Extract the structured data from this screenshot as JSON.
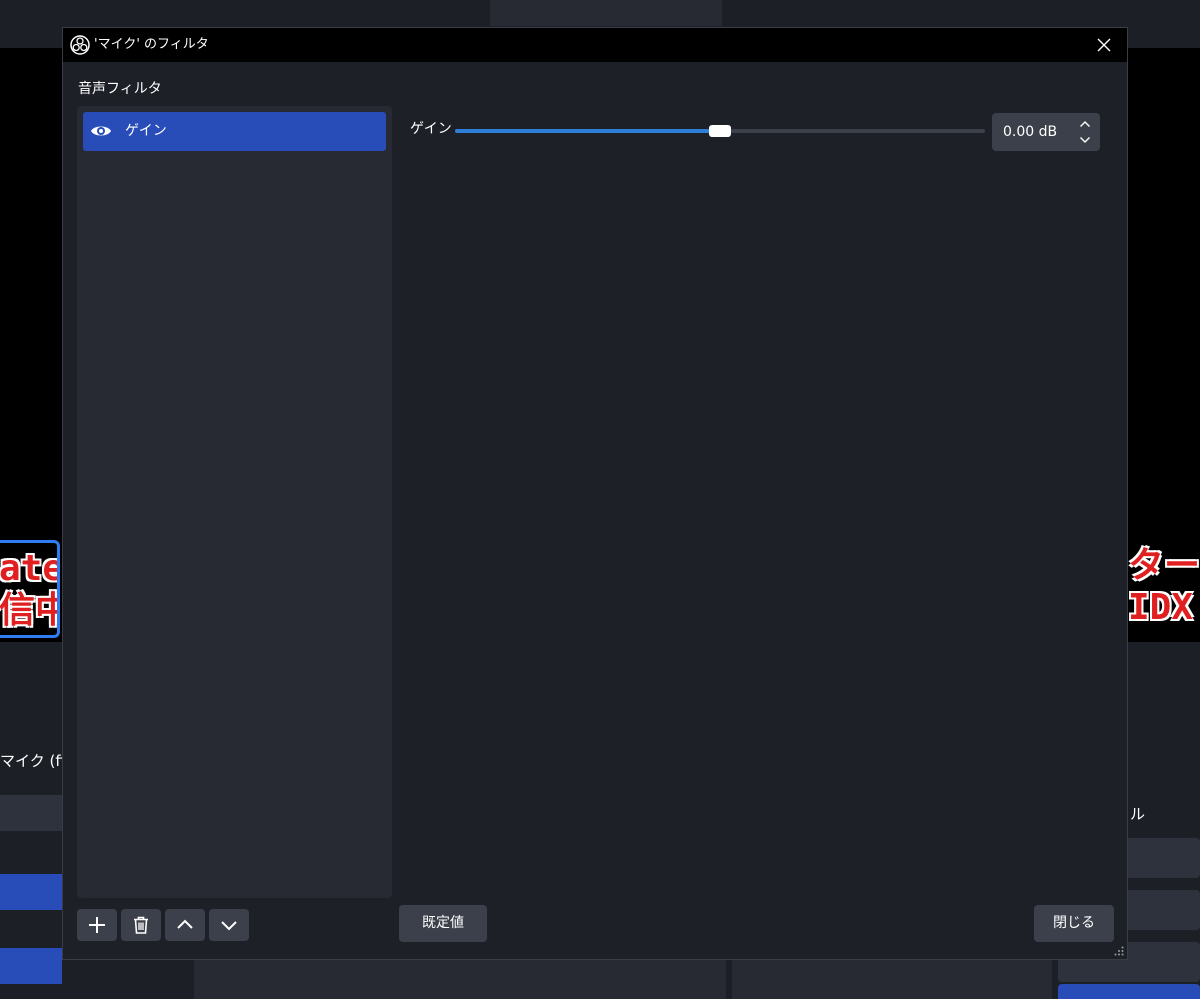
{
  "background": {
    "overlay_left_lines": [
      "ate",
      "信中"
    ],
    "overlay_right_lines": [
      "ター",
      "IDX"
    ],
    "audio_source_label": "マイク (fifin",
    "right_panel_label": "ル"
  },
  "dialog": {
    "title": "'マイク' のフィルタ",
    "close_icon": "close-icon",
    "section_label": "音声フィルタ",
    "filters": [
      {
        "label": "ゲイン",
        "visible": true,
        "selected": true
      }
    ],
    "list_buttons": {
      "add": "plus-icon",
      "remove": "trash-icon",
      "move_up": "chevron-up-icon",
      "move_down": "chevron-down-icon"
    },
    "gain": {
      "label": "ゲイン",
      "value_text": "0.00 dB",
      "slider_min": -30,
      "slider_max": 30,
      "slider_value": 0
    },
    "defaults_button": "既定値",
    "close_button": "閉じる"
  },
  "colors": {
    "accent": "#284cb8",
    "slider_fill": "#2d7fd8",
    "panel": "#272a33",
    "dialog_bg": "#1e2028",
    "button": "#3c404b"
  }
}
